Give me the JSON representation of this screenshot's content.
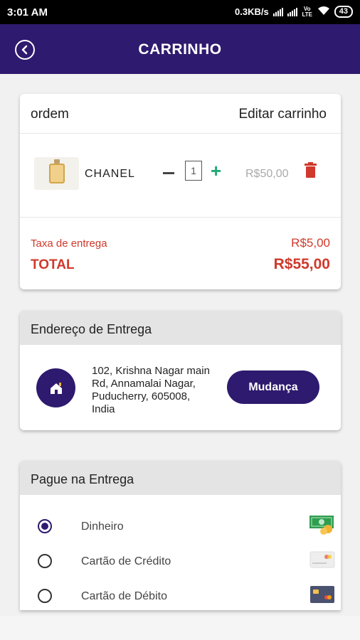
{
  "status_bar": {
    "time": "3:01 AM",
    "network_speed": "0.3KB/s",
    "volte": "Vo LTE",
    "battery": "43"
  },
  "app_bar": {
    "title": "CARRINHO",
    "back_icon": "back-arrow-circle-icon"
  },
  "order": {
    "header_left": "ordem",
    "header_right": "Editar carrinho",
    "item": {
      "name": "CHANEL",
      "quantity": "1",
      "price": "R$50,00",
      "image_icon": "perfume-bottle-icon"
    },
    "delivery_fee_label": "Taxa de entrega",
    "delivery_fee_value": "R$5,00",
    "total_label": "TOTAL",
    "total_value": "R$55,00"
  },
  "address": {
    "header": "Endereço de Entrega",
    "text": "102, Krishna Nagar main Rd, Annamalai Nagar, Puducherry, 605008, India",
    "change_button": "Mudança"
  },
  "payment": {
    "header": "Pague na Entrega",
    "options": [
      {
        "label": "Dinheiro",
        "selected": true,
        "icon": "cash-icon"
      },
      {
        "label": "Cartão de Crédito",
        "selected": false,
        "icon": "credit-card-icon"
      },
      {
        "label": "Cartão de Débito",
        "selected": false,
        "icon": "debit-card-icon"
      }
    ]
  },
  "colors": {
    "primary": "#2e1a6e",
    "danger": "#d0392b",
    "plus_green": "#1faa74"
  }
}
